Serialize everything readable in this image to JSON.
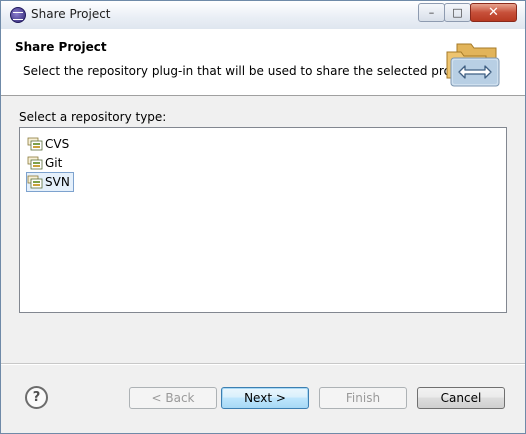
{
  "window": {
    "title": "Share Project",
    "controls": {
      "minimize": "–",
      "maximize": "□",
      "close": "✕"
    }
  },
  "header": {
    "title": "Share Project",
    "description": "Select the repository plug-in that will be used to share the selected project."
  },
  "content": {
    "section_label": "Select a repository type:",
    "repository_types": [
      {
        "label": "CVS",
        "selected": false
      },
      {
        "label": "Git",
        "selected": false
      },
      {
        "label": "SVN",
        "selected": true
      }
    ]
  },
  "footer": {
    "help_label": "?",
    "buttons": {
      "back": "< Back",
      "next": "Next >",
      "finish": "Finish",
      "cancel": "Cancel"
    }
  },
  "colors": {
    "title_bar": "#e9eef5",
    "close_button": "#c7503a",
    "selection": "#e5f0fb",
    "default_button_border": "#3c7fb1"
  }
}
